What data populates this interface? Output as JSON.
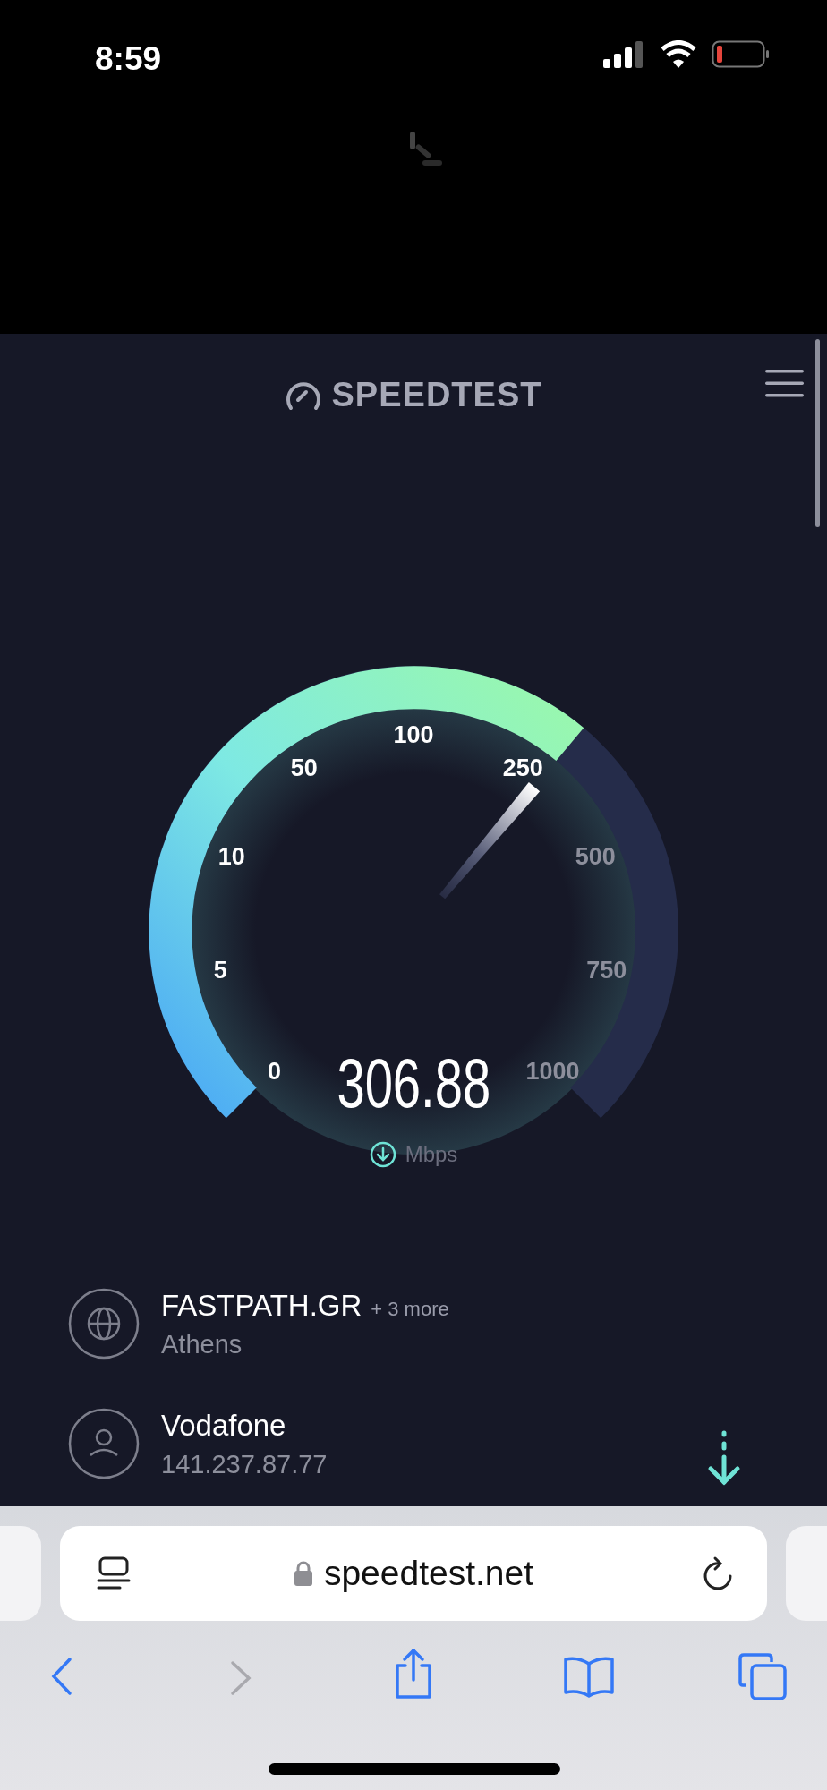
{
  "status_bar": {
    "time": "8:59"
  },
  "header": {
    "logo": "SPEEDTEST"
  },
  "gauge": {
    "ticks": [
      {
        "label": "0",
        "passed": true
      },
      {
        "label": "5",
        "passed": true
      },
      {
        "label": "10",
        "passed": true
      },
      {
        "label": "50",
        "passed": true
      },
      {
        "label": "100",
        "passed": true
      },
      {
        "label": "250",
        "passed": true
      },
      {
        "label": "500",
        "passed": false
      },
      {
        "label": "750",
        "passed": false
      },
      {
        "label": "1000",
        "passed": false
      }
    ],
    "reading": "306.88",
    "unit": "Mbps"
  },
  "connections": [
    {
      "kind": "server",
      "name": "FASTPATH.GR",
      "extra": "+ 3 more",
      "detail": "Athens"
    },
    {
      "kind": "provider",
      "name": "Vodafone",
      "detail": "141.237.87.77"
    }
  ],
  "browser": {
    "url": "speedtest.net",
    "forward_disabled": true
  }
}
